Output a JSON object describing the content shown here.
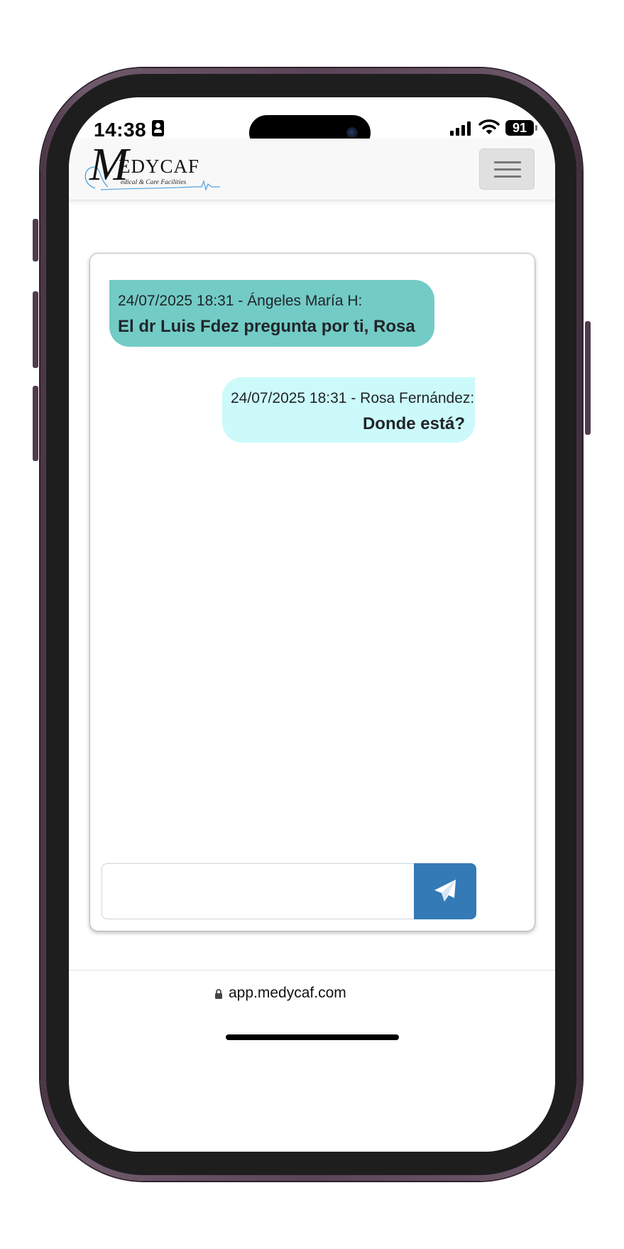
{
  "status_bar": {
    "time": "14:38",
    "battery": "91",
    "icons": [
      "contact-badge-icon",
      "cellular-signal-icon",
      "wifi-icon",
      "battery-icon"
    ]
  },
  "navbar": {
    "logo": {
      "initial": "M",
      "name": "EDYCAF",
      "tagline": "edical & Care Facilities"
    },
    "menu_toggle_icon": "hamburger-icon"
  },
  "chat": {
    "messages": [
      {
        "direction": "received",
        "meta": "24/07/2025 18:31 - Ángeles María H:",
        "text": "El dr Luis Fdez pregunta por ti, Rosa"
      },
      {
        "direction": "sent",
        "meta": "24/07/2025 18:31 -  Rosa Fernández:",
        "text": "Donde está?"
      }
    ],
    "input": {
      "value": "",
      "placeholder": ""
    },
    "send_icon": "paper-plane-icon"
  },
  "browser": {
    "url": "app.medycaf.com",
    "lock_icon": "lock-icon"
  },
  "colors": {
    "received_bubble": "#73cbc6",
    "sent_bubble": "#ccfafa",
    "send_button": "#337ab7",
    "phone_frame": "#5a4457"
  }
}
